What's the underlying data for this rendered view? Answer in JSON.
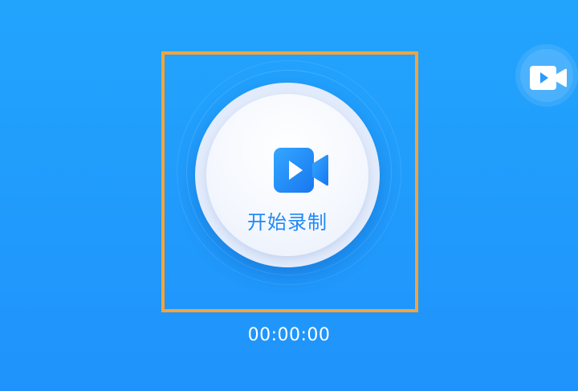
{
  "recorder": {
    "start_label": "开始录制",
    "timer": "00:00:00"
  },
  "icons": {
    "main": "video-camera-play-icon",
    "side": "video-camera-play-icon"
  },
  "colors": {
    "background_top": "#22a4fd",
    "background_bottom": "#1f93fb",
    "accent": "#1f8af6",
    "highlight": "#f3a33c"
  }
}
